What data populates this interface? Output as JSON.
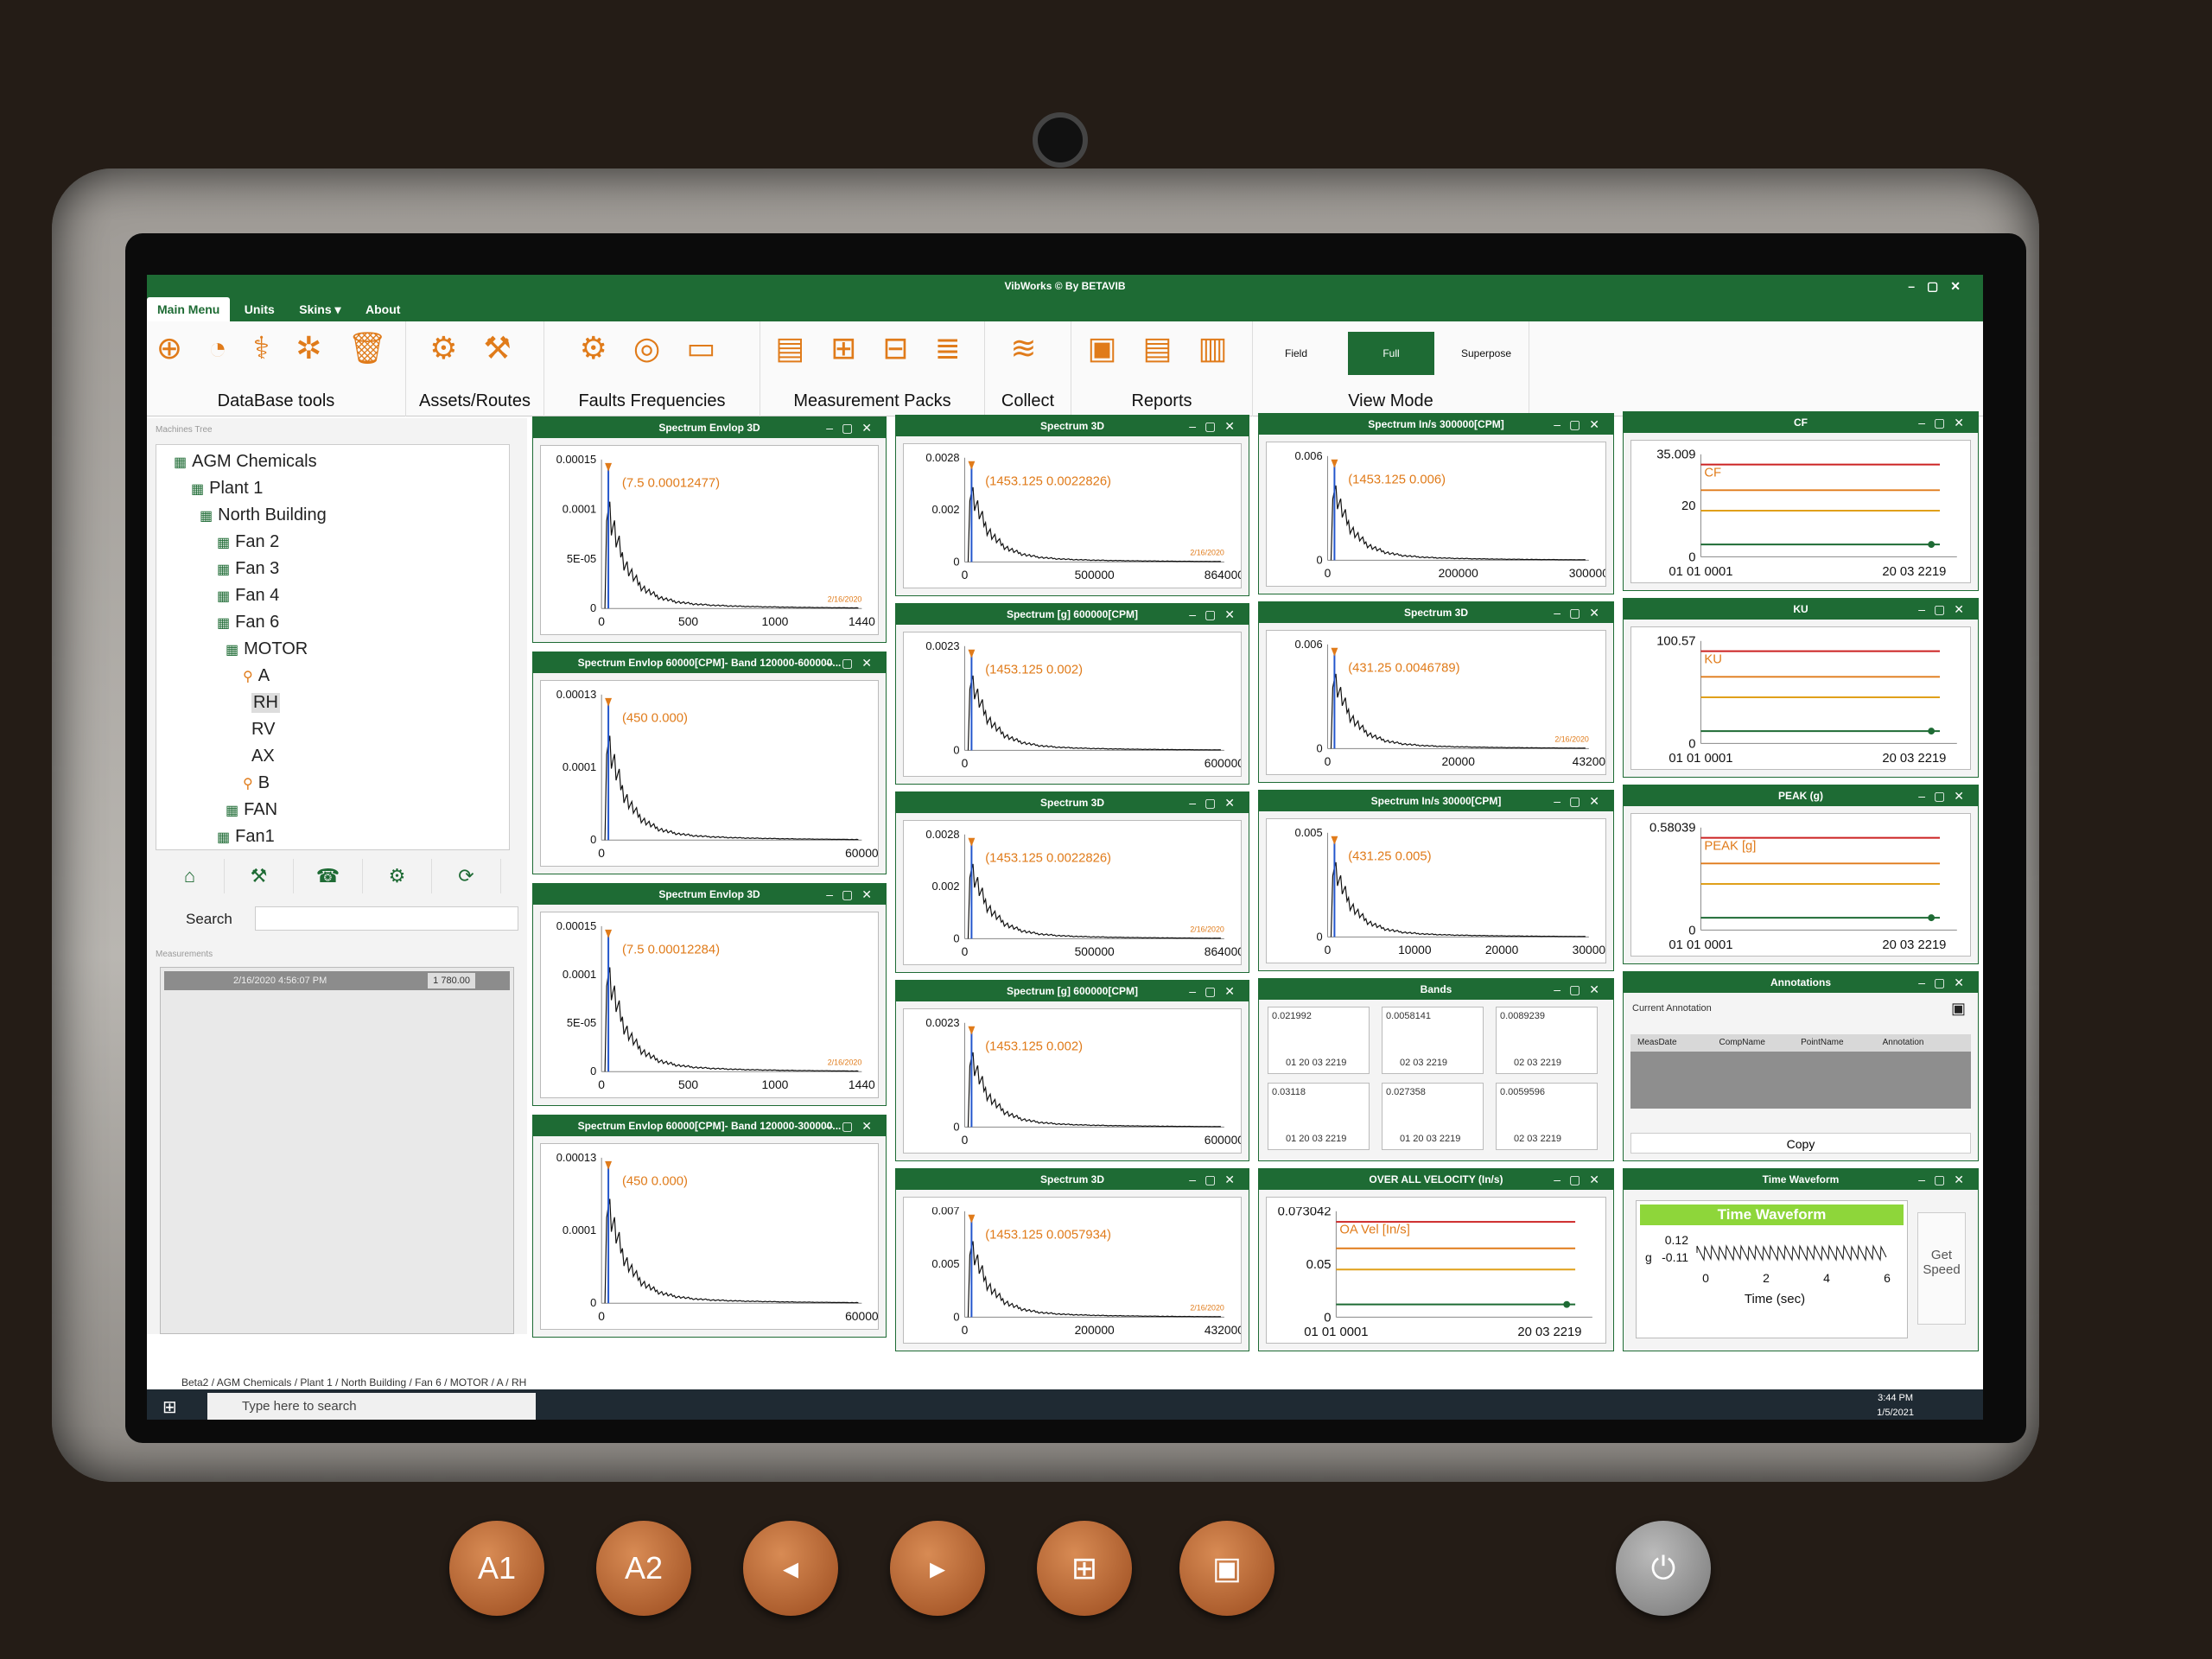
{
  "app": {
    "title": "VibWorks © By BETAVIB",
    "tabs": [
      "Main Menu",
      "Units",
      "Skins ▾",
      "About"
    ]
  },
  "ribbon": {
    "groups": [
      {
        "label": "DataBase tools"
      },
      {
        "label": "Assets/Routes"
      },
      {
        "label": "Faults Frequencies"
      },
      {
        "label": "Measurement Packs"
      },
      {
        "label": "Collect"
      },
      {
        "label": "Reports"
      },
      {
        "label": "View Mode"
      }
    ],
    "view_modes": [
      "Field",
      "Full",
      "Superpose"
    ],
    "active_view": "Full"
  },
  "sidebar": {
    "tree_title": "Machines Tree",
    "tree": [
      {
        "label": "AGM Chemicals",
        "icon": "factory-icon"
      },
      {
        "label": "Plant 1",
        "icon": "plant-icon"
      },
      {
        "label": "North Building",
        "icon": "building-icon"
      },
      {
        "label": "Fan 2",
        "icon": "machine-icon"
      },
      {
        "label": "Fan 3",
        "icon": "machine-icon"
      },
      {
        "label": "Fan 4",
        "icon": "machine-icon"
      },
      {
        "label": "Fan 6",
        "icon": "machine-icon"
      },
      {
        "label": "MOTOR",
        "icon": "motor-icon"
      },
      {
        "label": "A",
        "icon": "pin-icon"
      },
      {
        "label": "RH",
        "icon": ""
      },
      {
        "label": "RV",
        "icon": ""
      },
      {
        "label": "AX",
        "icon": ""
      },
      {
        "label": "B",
        "icon": "pin-icon"
      },
      {
        "label": "FAN",
        "icon": "motor-icon"
      },
      {
        "label": "Fan1",
        "icon": "machine-icon"
      }
    ],
    "search_label": "Search",
    "measurements_title": "Measurements",
    "measurement_row": {
      "date": "2/16/2020 4:56:07 PM",
      "value": "1 780.00"
    }
  },
  "panels": {
    "p1": {
      "title": "Spectrum Envlop 3D",
      "y_ticks": [
        "0.00015",
        "0.0001",
        "5E-05",
        "0"
      ],
      "x_ticks": [
        "0",
        "500",
        "1000",
        "1440"
      ],
      "cursor": "(7.5  0.00012477)",
      "date": "2/16/2020"
    },
    "p2": {
      "title": "Spectrum Envlop 60000[CPM]- Band 120000-600000...",
      "y_ticks": [
        "0.00013",
        "0.0001",
        "0"
      ],
      "x_ticks": [
        "0",
        "60000"
      ],
      "cursor": "(450  0.000)"
    },
    "p3": {
      "title": "Spectrum Envlop 3D",
      "y_ticks": [
        "0.00015",
        "0.0001",
        "5E-05",
        "0"
      ],
      "x_ticks": [
        "0",
        "500",
        "1000",
        "1440"
      ],
      "cursor": "(7.5  0.00012284)",
      "date": "2/16/2020"
    },
    "p4": {
      "title": "Spectrum Envlop 60000[CPM]- Band 120000-300000...",
      "y_ticks": [
        "0.00013",
        "0.0001",
        "0"
      ],
      "x_ticks": [
        "0",
        "60000"
      ],
      "cursor": "(450  0.000)"
    },
    "p5": {
      "title": "Spectrum 3D",
      "y_ticks": [
        "0.0028",
        "0.002",
        "0"
      ],
      "x_ticks": [
        "0",
        "500000",
        "864000"
      ],
      "cursor": "(1453.125  0.0022826)",
      "date": "2/16/2020"
    },
    "p6": {
      "title": "Spectrum  [g] 600000[CPM]",
      "y_ticks": [
        "0.0023",
        "0"
      ],
      "x_ticks": [
        "0",
        "600000"
      ],
      "cursor": "(1453.125  0.002)"
    },
    "p7": {
      "title": "Spectrum 3D",
      "y_ticks": [
        "0.0028",
        "0.002",
        "0"
      ],
      "x_ticks": [
        "0",
        "500000",
        "864000"
      ],
      "cursor": "(1453.125  0.0022826)",
      "date": "2/16/2020"
    },
    "p8": {
      "title": "Spectrum  [g] 600000[CPM]",
      "y_ticks": [
        "0.0023",
        "0"
      ],
      "x_ticks": [
        "0",
        "600000"
      ],
      "cursor": "(1453.125  0.002)"
    },
    "p9": {
      "title": "Spectrum 3D",
      "y_ticks": [
        "0.007",
        "0.005",
        "0"
      ],
      "x_ticks": [
        "0",
        "200000",
        "432000"
      ],
      "cursor": "(1453.125  0.0057934)",
      "date": "2/16/2020"
    },
    "p10": {
      "title": "Spectrum  In/s 300000[CPM]",
      "y_ticks": [
        "0.006",
        "0"
      ],
      "x_ticks": [
        "0",
        "200000",
        "300000"
      ],
      "cursor": "(1453.125  0.006)"
    },
    "p11": {
      "title": "Spectrum 3D",
      "y_ticks": [
        "0.006",
        "0"
      ],
      "x_ticks": [
        "0",
        "20000",
        "43200"
      ],
      "cursor": "(431.25  0.0046789)",
      "date": "2/16/2020"
    },
    "p12": {
      "title": "Spectrum  In/s 30000[CPM]",
      "y_ticks": [
        "0.005",
        "0"
      ],
      "x_ticks": [
        "0",
        "10000",
        "20000",
        "30000"
      ],
      "cursor": "(431.25  0.005)"
    },
    "bands": {
      "title": "Bands",
      "cells": [
        {
          "value": "0.021992",
          "date": "01 20 03 2219"
        },
        {
          "value": "0.0058141",
          "date": "02 03 2219"
        },
        {
          "value": "0.0089239",
          "date": "02 03 2219"
        },
        {
          "value": "0.03118",
          "date": "01 20 03 2219"
        },
        {
          "value": "0.027358",
          "date": "01 20 03 2219"
        },
        {
          "value": "0.0059596",
          "date": "02 03 2219"
        }
      ]
    },
    "oa": {
      "title": "OVER ALL VELOCITY (In/s)",
      "y_ticks": [
        "0.073042",
        "0.05",
        "0"
      ],
      "x_ticks": [
        "01 01 0001",
        "20 03 2219"
      ],
      "legend": "OA Vel [In/s]"
    },
    "cf": {
      "title": "CF",
      "y_ticks": [
        "35.009",
        "20",
        "0"
      ],
      "x_ticks": [
        "01 01 0001",
        "20 03 2219"
      ],
      "legend": "CF"
    },
    "ku": {
      "title": "KU",
      "y_ticks": [
        "100.57",
        "0"
      ],
      "x_ticks": [
        "01 01 0001",
        "20 03 2219"
      ],
      "legend": "KU"
    },
    "peak": {
      "title": "PEAK (g)",
      "y_ticks": [
        "0.58039",
        "0"
      ],
      "x_ticks": [
        "01 01 0001",
        "20 03 2219"
      ],
      "legend": "PEAK [g]"
    },
    "annotations": {
      "title": "Annotations",
      "current": "Current Annotation",
      "columns": [
        "MeasDate",
        "CompName",
        "PointName",
        "Annotation"
      ],
      "copy": "Copy"
    },
    "tw": {
      "title": "Time Waveform",
      "banner": "Time Waveform",
      "y_ticks": [
        "0.12",
        "-0.11"
      ],
      "ylabel": "g",
      "x_ticks": [
        "0",
        "2",
        "4",
        "6"
      ],
      "xlabel": "Time (sec)",
      "button": "Get Speed"
    }
  },
  "statusbar": {
    "breadcrumb": "Beta2  /  AGM Chemicals  /  Plant 1  /  North Building  /  Fan 6  /  MOTOR  /  A  /  RH"
  },
  "taskbar": {
    "search": "Type here to search",
    "time": "3:44 PM",
    "date": "1/5/2021"
  },
  "hardware": {
    "buttons": [
      "A1",
      "A2",
      "",
      "",
      "",
      ""
    ]
  }
}
